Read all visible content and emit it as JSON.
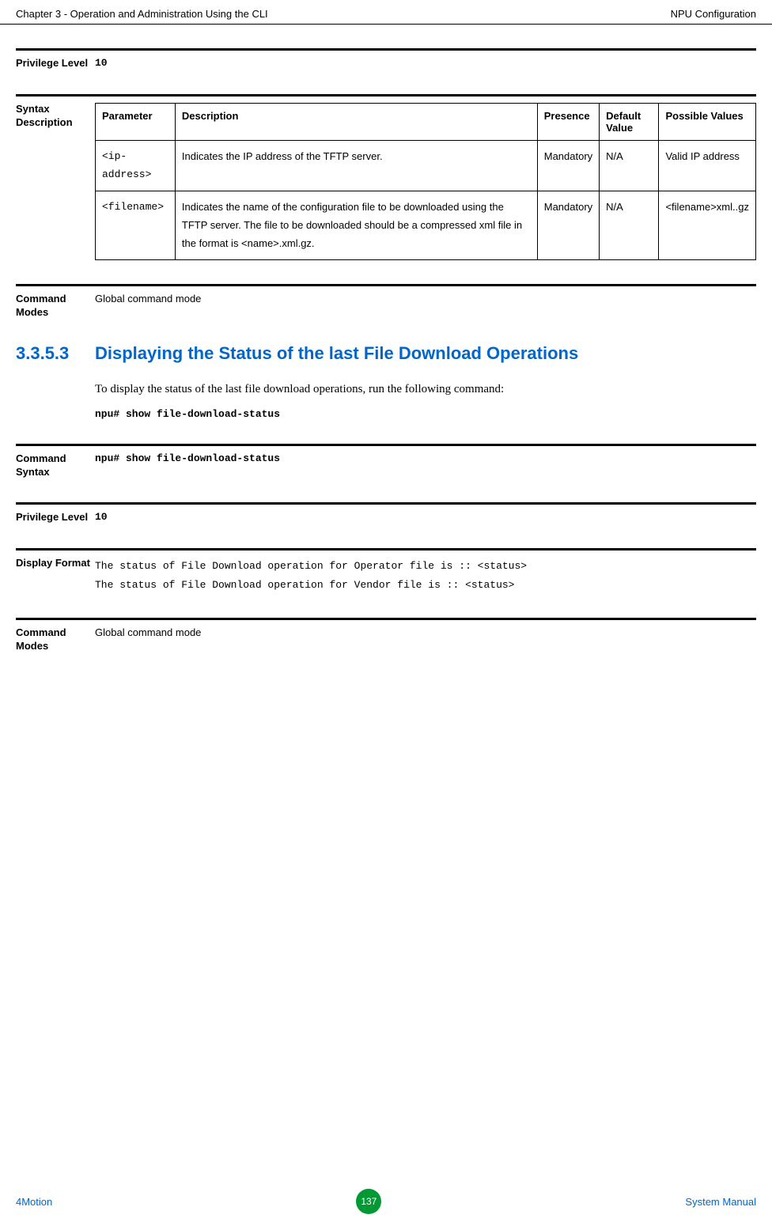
{
  "header": {
    "left": "Chapter 3 - Operation and Administration Using the CLI",
    "right": "NPU Configuration"
  },
  "privilege1": {
    "label": "Privilege Level",
    "value": "10"
  },
  "syntax_description": {
    "label": "Syntax Description",
    "headers": {
      "parameter": "Parameter",
      "description": "Description",
      "presence": "Presence",
      "default_value": "Default Value",
      "possible_values": "Possible Values"
    },
    "rows": [
      {
        "parameter": "<ip-address>",
        "description": "Indicates the IP address of the TFTP server.",
        "presence": "Mandatory",
        "default_value": "N/A",
        "possible_values": "Valid IP address"
      },
      {
        "parameter": "<filename>",
        "description": "Indicates the name of the configuration file to be downloaded using the TFTP server. The file to be downloaded should be a compressed xml file in the format is <name>.xml.gz.",
        "presence": "Mandatory",
        "default_value": "N/A",
        "possible_values": "<filename>xml..gz"
      }
    ]
  },
  "command_modes1": {
    "label": "Command Modes",
    "value": "Global command mode"
  },
  "section_heading": {
    "number": "3.3.5.3",
    "title": "Displaying the Status of the last File Download Operations"
  },
  "body": {
    "paragraph": "To display the status of the last file download operations, run the following command:",
    "code": "npu# show file-download-status"
  },
  "command_syntax": {
    "label": "Command Syntax",
    "value": "npu# show file-download-status"
  },
  "privilege2": {
    "label": "Privilege Level",
    "value": "10"
  },
  "display_format": {
    "label": "Display Format",
    "line1": "The status of File Download operation for Operator file is :: <status>",
    "line2": "The status of File Download operation for Vendor file is :: <status>"
  },
  "command_modes2": {
    "label": "Command Modes",
    "value": "Global command mode"
  },
  "footer": {
    "left": "4Motion",
    "page": "137",
    "right": "System Manual"
  }
}
